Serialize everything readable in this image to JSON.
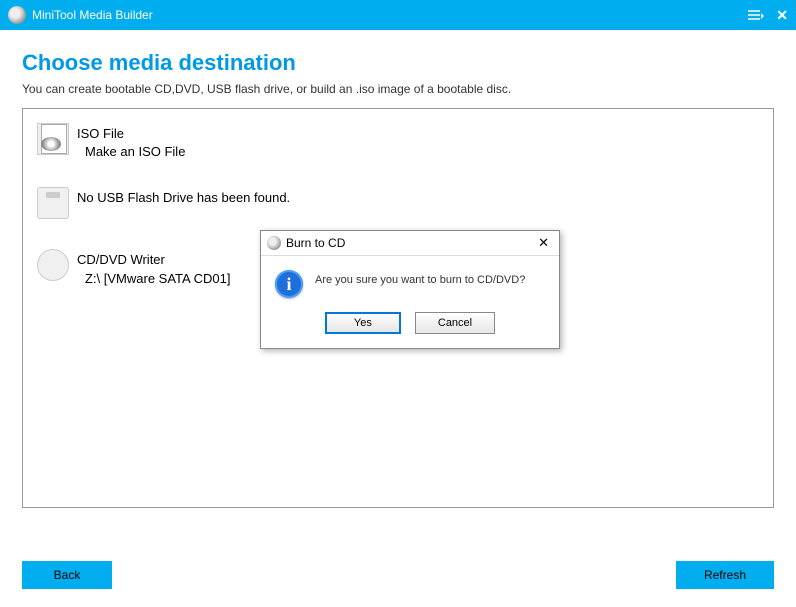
{
  "titlebar": {
    "app_name": "MiniTool Media Builder"
  },
  "page": {
    "title": "Choose media destination",
    "subtitle": "You can create bootable CD,DVD, USB flash drive, or build an .iso image of a bootable disc."
  },
  "media_items": [
    {
      "label": "ISO File",
      "sub": "Make an ISO File"
    },
    {
      "label": "No USB Flash Drive has been found.",
      "sub": ""
    },
    {
      "label": "CD/DVD Writer",
      "sub": "Z:\\ [VMware SATA CD01]"
    }
  ],
  "buttons": {
    "back": "Back",
    "refresh": "Refresh"
  },
  "dialog": {
    "title": "Burn to CD",
    "message": "Are you sure you want to burn to CD/DVD?",
    "yes": "Yes",
    "cancel": "Cancel"
  }
}
